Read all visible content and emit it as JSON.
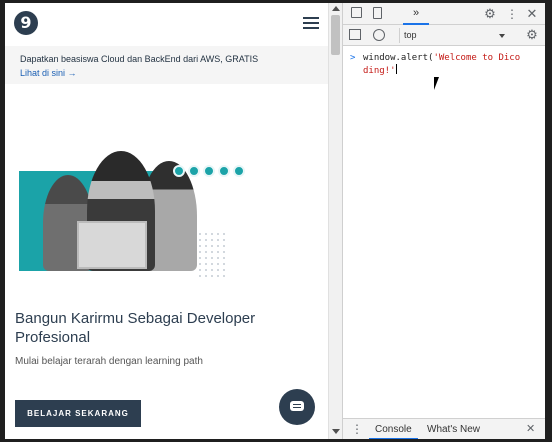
{
  "page": {
    "logo_glyph": "9",
    "promo_text": "Dapatkan beasiswa Cloud dan BackEnd dari AWS, GRATIS",
    "promo_link": "Lihat di sini →",
    "hero_title": "Bangun Karirmu Sebagai Developer Profesional",
    "hero_subtitle": "Mulai belajar terarah dengan learning path",
    "cta_label": "BELAJAR SEKARANG"
  },
  "devtools": {
    "more_tabs_label": "»",
    "settings_glyph": "⚙",
    "kebab_glyph": "⋮",
    "close_glyph": "✕",
    "context": "top",
    "console_settings_glyph": "⚙",
    "prompt_glyph": ">",
    "code_prefix": "window.alert(",
    "code_string": "'Welcome to Dicoding!'",
    "drawer_menu_glyph": "⋮",
    "drawer_tabs": [
      "Console",
      "What's New"
    ],
    "drawer_close_glyph": "✕"
  },
  "colors": {
    "brand": "#2d3e50",
    "accent_teal": "#1ba3a8",
    "devtools_active": "#1a73e8"
  }
}
